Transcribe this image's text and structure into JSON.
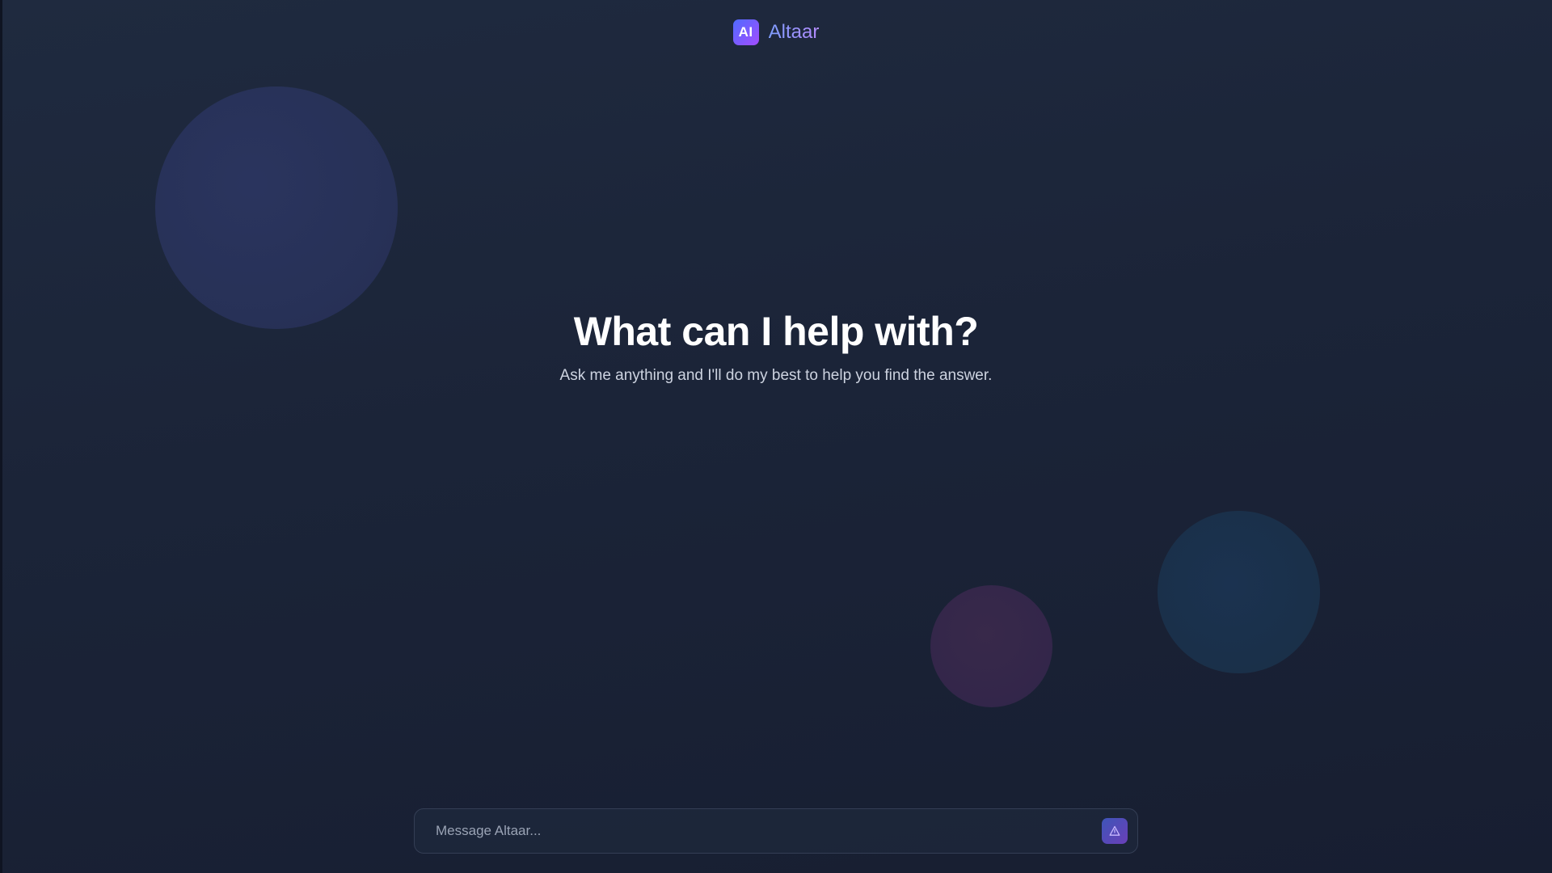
{
  "brand": {
    "logo_text": "AI",
    "name": "Altaar",
    "logo_colors": [
      "#4f6bff",
      "#a34dff"
    ]
  },
  "hero": {
    "title": "What can I help with?",
    "subtitle": "Ask me anything and I'll do my best to help you find the answer."
  },
  "composer": {
    "placeholder": "Message Altaar...",
    "value": "",
    "send_icon": "send-triangle-icon"
  },
  "colors": {
    "background": "#1c2539",
    "accent": "#6a5cff",
    "text": "#ffffff",
    "subtext": "#cdd3e0"
  }
}
